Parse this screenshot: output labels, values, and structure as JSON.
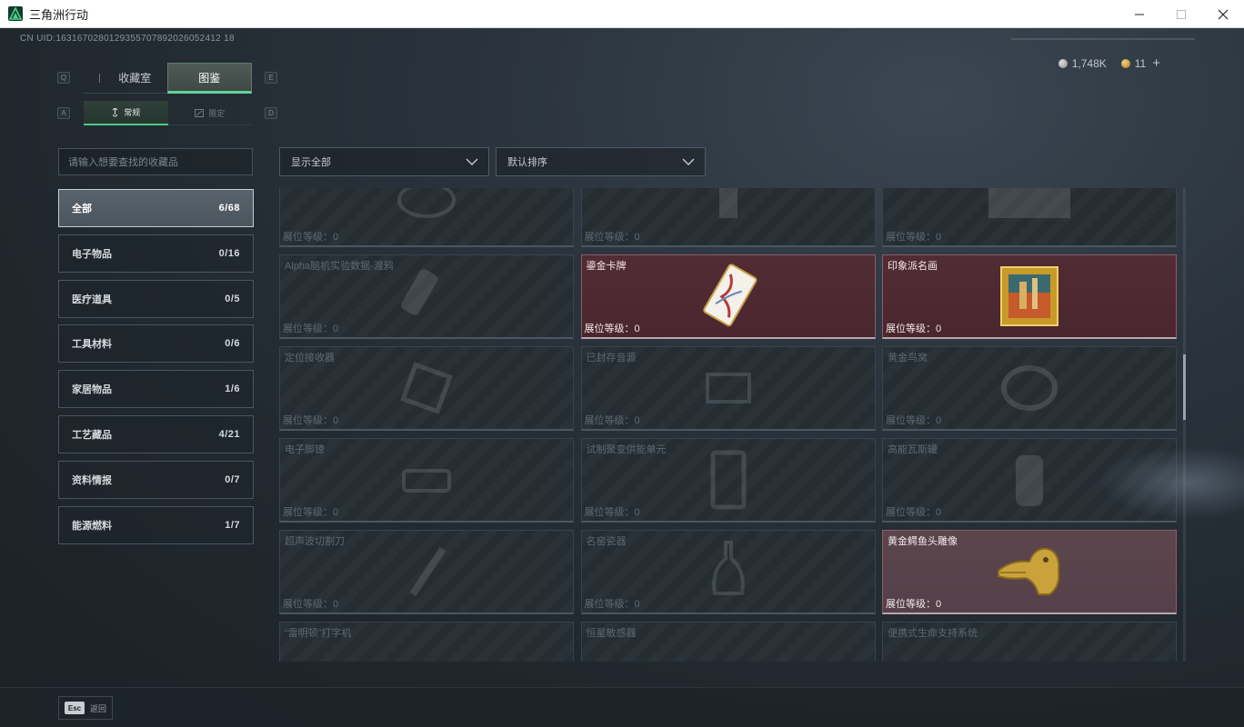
{
  "window": {
    "title": "三角洲行动",
    "min_icon": "minimize-icon",
    "max_icon": "maximize-icon",
    "close_icon": "close-icon"
  },
  "uid": "CN UID:1631670280129355707892026052412 18",
  "currency": {
    "silver": "1,748K",
    "gold": "11",
    "add": "+"
  },
  "tabs": {
    "left_key": "Q",
    "right_key": "E",
    "items": [
      "收藏室",
      "图鉴"
    ],
    "active": 1
  },
  "subtabs": {
    "left_key": "A",
    "right_key": "D",
    "items": [
      "常规",
      "限定"
    ],
    "active": 0
  },
  "search": {
    "placeholder": "请输入想要查找的收藏品"
  },
  "categories": [
    {
      "label": "全部",
      "count": "6/68"
    },
    {
      "label": "电子物品",
      "count": "0/16"
    },
    {
      "label": "医疗道具",
      "count": "0/5"
    },
    {
      "label": "工具材料",
      "count": "0/6"
    },
    {
      "label": "家居物品",
      "count": "1/6"
    },
    {
      "label": "工艺藏品",
      "count": "4/21"
    },
    {
      "label": "资料情报",
      "count": "0/7"
    },
    {
      "label": "能源燃料",
      "count": "1/7"
    }
  ],
  "filters": {
    "display": "显示全部",
    "sort": "默认排序"
  },
  "level_label": "展位等级：",
  "items": [
    {
      "name": "",
      "level": "0",
      "owned": false
    },
    {
      "name": "",
      "level": "0",
      "owned": false
    },
    {
      "name": "",
      "level": "0",
      "owned": false
    },
    {
      "name": "Alpha脑机实验数据-渡鸦",
      "level": "0",
      "owned": false
    },
    {
      "name": "鎏金卡牌",
      "level": "0",
      "owned": true
    },
    {
      "name": "印象派名画",
      "level": "0",
      "owned": true
    },
    {
      "name": "定位接收器",
      "level": "0",
      "owned": false
    },
    {
      "name": "已封存音源",
      "level": "0",
      "owned": false
    },
    {
      "name": "黄金鸟窝",
      "level": "0",
      "owned": false
    },
    {
      "name": "电子脚镣",
      "level": "0",
      "owned": false
    },
    {
      "name": "试制聚变供能单元",
      "level": "0",
      "owned": false
    },
    {
      "name": "高能瓦斯罐",
      "level": "0",
      "owned": false
    },
    {
      "name": "超声波切割刀",
      "level": "0",
      "owned": false
    },
    {
      "name": "名窑瓷器",
      "level": "0",
      "owned": false
    },
    {
      "name": "黄金鳄鱼头雕像",
      "level": "0",
      "owned": true
    },
    {
      "name": "“雷明顿”打字机",
      "level": "",
      "owned": false
    },
    {
      "name": "恒星敏感器",
      "level": "",
      "owned": false
    },
    {
      "name": "便携式生命支持系统",
      "level": "",
      "owned": false
    }
  ],
  "footer": {
    "esc": "Esc",
    "back": "返回"
  }
}
